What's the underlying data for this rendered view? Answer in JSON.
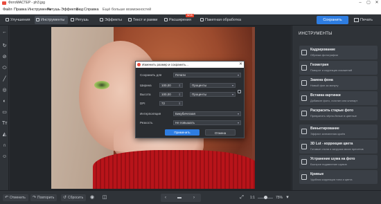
{
  "window": {
    "title": "ФотоМАСТЕР - ph3.jpg",
    "controls": [
      "–",
      "▢",
      "✕"
    ]
  },
  "menu": [
    "Файл",
    "Правка",
    "Инструменты",
    "Ретушь",
    "Эффекты",
    "Вид",
    "Справка",
    "Ещё больше возможностей"
  ],
  "toolbar": {
    "tabs": [
      {
        "label": "Улучшения"
      },
      {
        "label": "Инструменты"
      },
      {
        "label": "Ретушь"
      },
      {
        "label": "Эффекты"
      },
      {
        "label": "Текст и рамки"
      },
      {
        "label": "Расширения",
        "badge": "NEW"
      },
      {
        "label": "Пакетная обработка"
      }
    ],
    "active_tab": "Инструменты",
    "save_label": "Сохранить",
    "print_label": "Печать"
  },
  "dialog": {
    "title": "Изменить размер и сохранить...",
    "fields": {
      "save_for_label": "Сохранить для",
      "save_for_value": "Печати",
      "width_label": "Ширина",
      "width_value": "100,00",
      "width_unit": "Проценты",
      "height_label": "Высота",
      "height_value": "100,00",
      "height_unit": "Проценты",
      "dpi_label": "DPI",
      "dpi_value": "72",
      "interp_label": "Интерполяция",
      "interp_value": "Бикубическая",
      "sharp_label": "Резкость",
      "sharp_value": "Не повышать"
    },
    "apply_label": "Применить",
    "cancel_label": "Отмена"
  },
  "panel": {
    "title": "ИНСТРУМЕНТЫ",
    "items": [
      {
        "title": "Кадрирование",
        "subtitle": "Обрезка фотографии"
      },
      {
        "title": "Геометрия",
        "subtitle": "Поворот и коррекция искажений"
      },
      {
        "title": "Замена фона",
        "subtitle": "Новый фон за минуту"
      },
      {
        "title": "Вставка картинки",
        "subtitle": "Добавьте фото, логотип или клипарт"
      },
      {
        "title": "Раскрасить старые фото",
        "subtitle": "Превратить чёрно-белые в цветные"
      },
      {
        "title": "Виньетирование",
        "subtitle": "Эффект затемнения краёв"
      },
      {
        "title": "3D Lut - коррекция цвета",
        "subtitle": "Готовые стили и загрузка своих пресетов"
      },
      {
        "title": "Устранение шума на фото",
        "subtitle": "Быстрое подавление шумов"
      },
      {
        "title": "Кривые",
        "subtitle": "Удобная коррекция тона и цвета"
      }
    ]
  },
  "bottom": {
    "undo_label": "Отменить",
    "redo_label": "Повторить",
    "reset_label": "Сбросить",
    "scale_label": "1:1",
    "zoom_value": "75%",
    "zoom_fraction": 0.5
  },
  "colors": {
    "accent": "#2e7de1",
    "panel": "#2f3338",
    "canvas": "#23262a"
  }
}
